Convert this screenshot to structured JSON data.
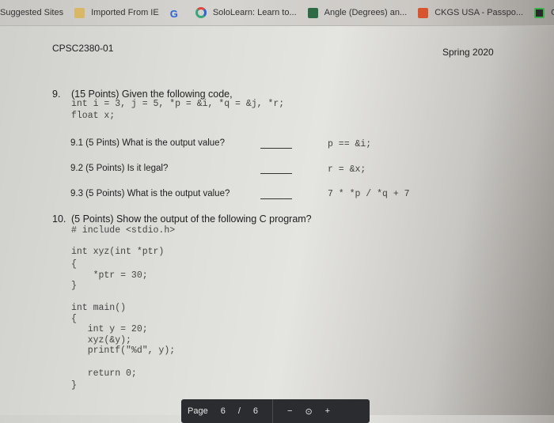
{
  "bookmarks": [
    {
      "label": "Suggested Sites",
      "icon": "none"
    },
    {
      "label": "Imported From IE",
      "icon": "folder-icon"
    },
    {
      "label": "",
      "icon": "google-icon"
    },
    {
      "label": "SoloLearn: Learn to...",
      "icon": "sololearn-icon"
    },
    {
      "label": "Angle (Degrees) an...",
      "icon": "angle-site-icon"
    },
    {
      "label": "CKGS USA - Passpo...",
      "icon": "ckgs-icon"
    },
    {
      "label": "Cygw",
      "icon": "cygwin-icon"
    }
  ],
  "google_glyph": "G",
  "header": {
    "course": "CPSC2380-01",
    "term": "Spring 2020"
  },
  "q9": {
    "number": "9.",
    "title": "(15 Points) Given the following code,",
    "code": [
      "int i = 3, j = 5, *p = &i, *q = &j, *r;",
      "float x;"
    ],
    "subs": [
      {
        "label": "9.1 (5 Pints) What is the output value?",
        "expr": "p == &i;"
      },
      {
        "label": "9.2 (5 Points) Is it legal?",
        "expr": "r = &x;"
      },
      {
        "label": "9.3 (5 Points) What is the output value?",
        "expr": "7 * *p / *q + 7"
      }
    ]
  },
  "q10": {
    "number": "10.",
    "title": "(5 Points) Show the output of the following C program?",
    "code": [
      "# include <stdio.h>",
      "",
      "int xyz(int *ptr)",
      "{",
      "    *ptr = 30;",
      "}",
      "",
      "int main()",
      "{",
      "   int y = 20;",
      "   xyz(&y);",
      "   printf(\"%d\", y);",
      "",
      "   return 0;",
      "}"
    ]
  },
  "pdf_toolbar": {
    "page_label": "Page",
    "page_current": "6",
    "page_sep": "/",
    "page_total": "6",
    "zoom_out": "−",
    "zoom_fit": "⊙",
    "zoom_in": "+"
  }
}
